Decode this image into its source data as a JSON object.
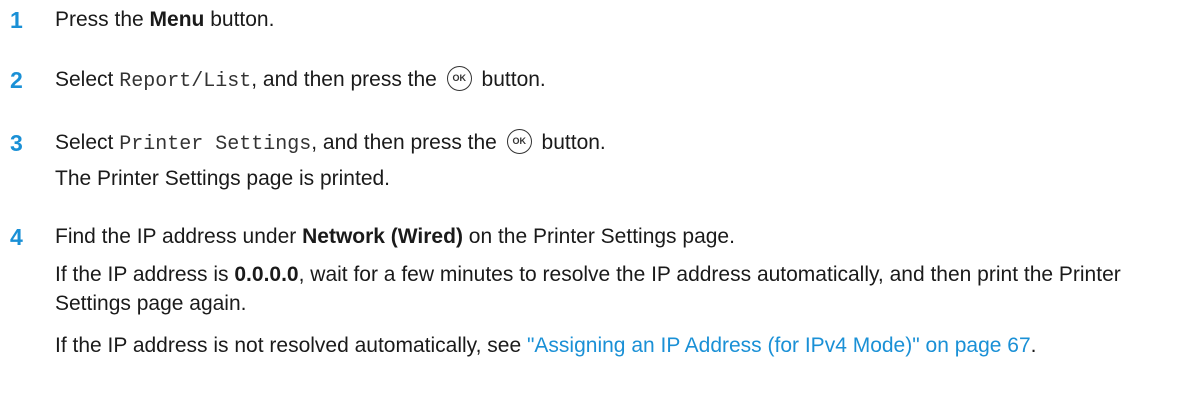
{
  "steps": [
    {
      "number": "1",
      "pre": "Press the ",
      "bold": "Menu",
      "post": " button."
    },
    {
      "number": "2",
      "pre": "Select ",
      "code": "Report/List",
      "mid": ", and then press the ",
      "icon_label": "OK",
      "post": " button."
    },
    {
      "number": "3",
      "pre": "Select ",
      "code": "Printer Settings",
      "mid": ", and then press the ",
      "icon_label": "OK",
      "post": " button.",
      "result": "The Printer Settings page is printed."
    },
    {
      "number": "4",
      "pre": "Find the IP address under ",
      "bold": "Network (Wired)",
      "post": " on the Printer Settings page.",
      "para1_pre": "If the IP address is ",
      "para1_bold": "0.0.0.0",
      "para1_post": ", wait for a few minutes to resolve the IP address automatically, and then print the Printer Settings page again.",
      "para2_pre": "If the IP address is not resolved automatically, see ",
      "para2_link": "\"Assigning an IP Address (for IPv4 Mode)\" on page 67",
      "para2_post": "."
    }
  ]
}
